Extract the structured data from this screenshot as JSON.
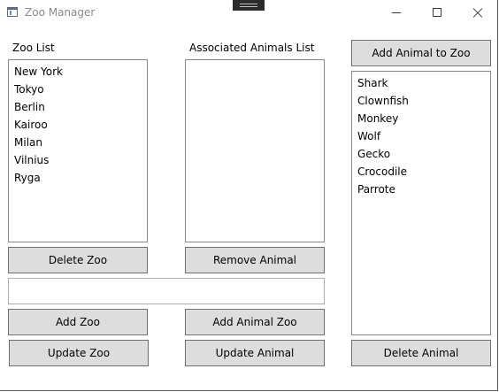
{
  "window": {
    "title": "Zoo Manager"
  },
  "zoo_list": {
    "label": "Zoo List",
    "items": [
      "New York",
      "Tokyo",
      "Berlin",
      "Kairoo",
      "Milan",
      "Vilnius",
      "Ryga"
    ]
  },
  "associated_animals": {
    "label": "Associated Animals List",
    "items": []
  },
  "all_animals": {
    "items": [
      "Shark",
      "Clownfish",
      "Monkey",
      "Wolf",
      "Gecko",
      "Crocodile",
      "Parrote"
    ]
  },
  "input": {
    "value": "",
    "placeholder": ""
  },
  "buttons": {
    "add_animal_to_zoo": "Add Animal to Zoo",
    "delete_zoo": "Delete Zoo",
    "remove_animal": "Remove Animal",
    "add_zoo": "Add Zoo",
    "add_animal_zoo": "Add Animal Zoo",
    "update_zoo": "Update Zoo",
    "update_animal": "Update Animal",
    "delete_animal": "Delete Animal"
  }
}
